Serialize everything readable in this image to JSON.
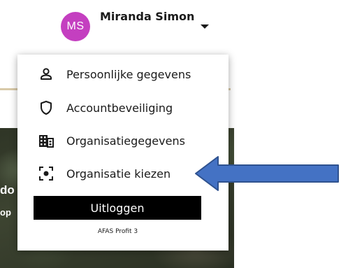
{
  "user": {
    "initials": "MS",
    "name": "Miranda Simon",
    "avatar_color": "#c43fc0"
  },
  "menu": {
    "items": [
      {
        "label": "Persoonlijke gegevens",
        "icon": "person-icon"
      },
      {
        "label": "Accountbeveiliging",
        "icon": "shield-icon"
      },
      {
        "label": "Organisatiegegevens",
        "icon": "building-icon"
      },
      {
        "label": "Organisatie kiezen",
        "icon": "focus-target-icon"
      }
    ],
    "logout_label": "Uitloggen",
    "product_label": "AFAS Profit 3"
  },
  "background": {
    "text_1": "do",
    "text_2": "op"
  },
  "annotation": {
    "arrow_color": "#4472c4",
    "arrow_icon": "left-arrow-icon"
  }
}
